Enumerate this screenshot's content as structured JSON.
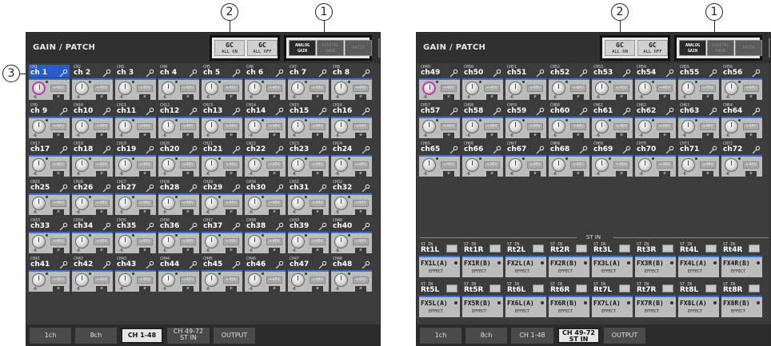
{
  "callouts": {
    "one": "1",
    "two": "2",
    "three": "3"
  },
  "left": {
    "title": "GAIN / PATCH",
    "gc_on": {
      "main": "GC",
      "sub": "ALL ON"
    },
    "gc_off": {
      "main": "GC",
      "sub": "ALL OFF"
    },
    "modes": {
      "analog": "ANALOG\nGAIN",
      "digital": "DIGITAL\nGAIN",
      "patch": "PATCH"
    },
    "close": "×",
    "rows": [
      [
        [
          "CH1",
          "ch 1"
        ],
        [
          "CH2",
          "ch 2"
        ],
        [
          "CH3",
          "ch 3"
        ],
        [
          "CH4",
          "ch 4"
        ],
        [
          "CH5",
          "ch 5"
        ],
        [
          "CH6",
          "ch 6"
        ],
        [
          "CH7",
          "ch 7"
        ],
        [
          "CH8",
          "ch 8"
        ]
      ],
      [
        [
          "CH9",
          "ch 9"
        ],
        [
          "CH10",
          "ch10"
        ],
        [
          "CH11",
          "ch11"
        ],
        [
          "CH12",
          "ch12"
        ],
        [
          "CH13",
          "ch13"
        ],
        [
          "CH14",
          "ch14"
        ],
        [
          "CH15",
          "ch15"
        ],
        [
          "CH16",
          "ch16"
        ]
      ],
      [
        [
          "CH17",
          "ch17"
        ],
        [
          "CH18",
          "ch18"
        ],
        [
          "CH19",
          "ch19"
        ],
        [
          "CH20",
          "ch20"
        ],
        [
          "CH21",
          "ch21"
        ],
        [
          "CH22",
          "ch22"
        ],
        [
          "CH23",
          "ch23"
        ],
        [
          "CH24",
          "ch24"
        ]
      ],
      [
        [
          "CH25",
          "ch25"
        ],
        [
          "CH26",
          "ch26"
        ],
        [
          "CH27",
          "ch27"
        ],
        [
          "CH28",
          "ch28"
        ],
        [
          "CH29",
          "ch29"
        ],
        [
          "CH30",
          "ch30"
        ],
        [
          "CH31",
          "ch31"
        ],
        [
          "CH32",
          "ch32"
        ]
      ],
      [
        [
          "CH33",
          "ch33"
        ],
        [
          "CH34",
          "ch34"
        ],
        [
          "CH35",
          "ch35"
        ],
        [
          "CH36",
          "ch36"
        ],
        [
          "CH37",
          "ch37"
        ],
        [
          "CH38",
          "ch38"
        ],
        [
          "CH39",
          "ch39"
        ],
        [
          "CH40",
          "ch40"
        ]
      ],
      [
        [
          "CH41",
          "ch41"
        ],
        [
          "CH42",
          "ch42"
        ],
        [
          "CH43",
          "ch43"
        ],
        [
          "CH44",
          "ch44"
        ],
        [
          "CH45",
          "ch45"
        ],
        [
          "CH46",
          "ch46"
        ],
        [
          "CH47",
          "ch47"
        ],
        [
          "CH48",
          "ch48"
        ]
      ]
    ],
    "tabs": [
      "1ch",
      "8ch",
      "CH 1-48",
      "CH 49-72\nST IN",
      "OUTPUT"
    ],
    "active_tab": 2
  },
  "right": {
    "title": "GAIN / PATCH",
    "gc_on": {
      "main": "GC",
      "sub": "ALL ON"
    },
    "gc_off": {
      "main": "GC",
      "sub": "ALL OFF"
    },
    "modes": {
      "analog": "ANALOG\nGAIN",
      "digital": "DIGITAL\nGAIN",
      "patch": "PATCH"
    },
    "close": "×",
    "rows": [
      [
        [
          "CH49",
          "ch49"
        ],
        [
          "CH50",
          "ch50"
        ],
        [
          "CH51",
          "ch51"
        ],
        [
          "CH52",
          "ch52"
        ],
        [
          "CH53",
          "ch53"
        ],
        [
          "CH54",
          "ch54"
        ],
        [
          "CH55",
          "ch55"
        ],
        [
          "CH56",
          "ch56"
        ]
      ],
      [
        [
          "CH57",
          "ch57"
        ],
        [
          "CH58",
          "ch58"
        ],
        [
          "CH59",
          "ch59"
        ],
        [
          "CH60",
          "ch60"
        ],
        [
          "CH61",
          "ch61"
        ],
        [
          "CH62",
          "ch62"
        ],
        [
          "CH63",
          "ch63"
        ],
        [
          "CH64",
          "ch64"
        ]
      ],
      [
        [
          "CH65",
          "ch65"
        ],
        [
          "CH66",
          "ch66"
        ],
        [
          "CH67",
          "ch67"
        ],
        [
          "CH68",
          "ch68"
        ],
        [
          "CH69",
          "ch69"
        ],
        [
          "CH70",
          "ch70"
        ],
        [
          "CH71",
          "ch71"
        ],
        [
          "CH72",
          "ch72"
        ]
      ]
    ],
    "stin_label": "ST IN",
    "stin_rows": [
      [
        [
          "ST IN",
          "Rt1L",
          "FX1L(A)"
        ],
        [
          "ST IN",
          "Rt1R",
          "FX1R(B)"
        ],
        [
          "ST IN",
          "Rt2L",
          "FX2L(A)"
        ],
        [
          "ST IN",
          "Rt2R",
          "FX2R(B)"
        ],
        [
          "ST IN",
          "Rt3L",
          "FX3L(A)"
        ],
        [
          "ST IN",
          "Rt3R",
          "FX3R(B)"
        ],
        [
          "ST IN",
          "Rt4L",
          "FX4L(A)"
        ],
        [
          "ST IN",
          "Rt4R",
          "FX4R(B)"
        ]
      ],
      [
        [
          "ST IN",
          "Rt5L",
          "FX5L(A)"
        ],
        [
          "ST IN",
          "Rt5R",
          "FX5R(B)"
        ],
        [
          "ST IN",
          "Rt6L",
          "FX6L(A)"
        ],
        [
          "ST IN",
          "Rt6R",
          "FX6R(B)"
        ],
        [
          "ST IN",
          "Rt7L",
          "FX7L(A)"
        ],
        [
          "ST IN",
          "Rt7R",
          "FX7R(B)"
        ],
        [
          "ST IN",
          "Rt8L",
          "FX8L(A)"
        ],
        [
          "ST IN",
          "Rt8R",
          "FX8R(B)"
        ]
      ]
    ],
    "effect_label": "EFFECT",
    "tabs": [
      "1ch",
      "8ch",
      "CH 1-48",
      "CH 49-72\nST IN",
      "OUTPUT"
    ],
    "active_tab": 3
  },
  "strip_common": {
    "v48": "+48V",
    "gain": "-6",
    "phase": "ø"
  },
  "colors": {
    "selected": "#2a5cc8",
    "accent_line": "#3f6fd0",
    "selected_ring": "#c23bb0"
  }
}
